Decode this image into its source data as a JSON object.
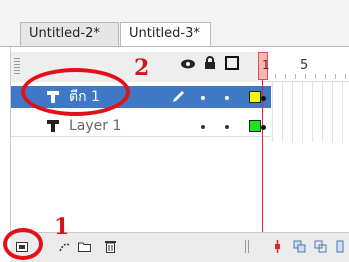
{
  "tabs": [
    {
      "label": "Untitled-2*"
    },
    {
      "label": "Untitled-3*"
    }
  ],
  "ruler": {
    "frame_1": "1",
    "frame_5": "5"
  },
  "layers": [
    {
      "name": "ตีก 1",
      "selected": true,
      "outline_color": "#f5f500"
    },
    {
      "name": "Layer 1",
      "selected": false,
      "outline_color": "#1ee61e"
    }
  ],
  "annotations": {
    "label_1": "1",
    "label_2": "2"
  },
  "colors": {
    "selection": "#3f79c6",
    "annotation": "#e3101a",
    "playhead": "#e0252b"
  }
}
